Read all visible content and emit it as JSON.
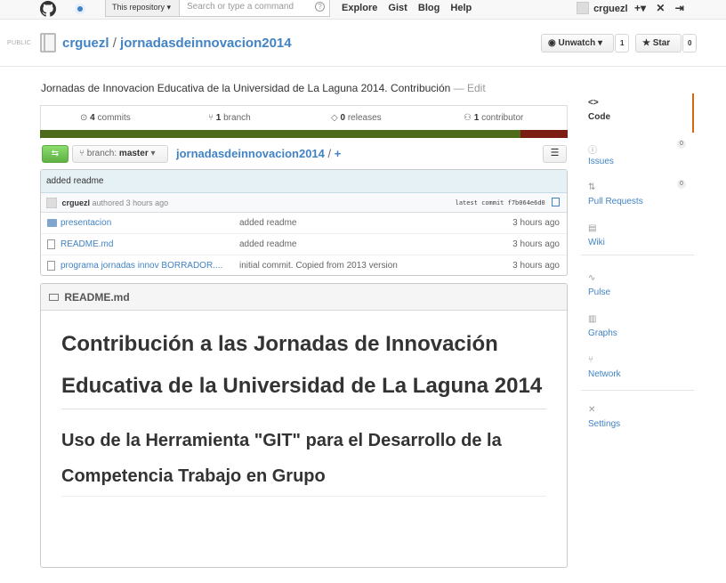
{
  "header": {
    "scope_label": "This repository",
    "search_placeholder": "Search or type a command",
    "help_glyph": "?",
    "nav": [
      "Explore",
      "Gist",
      "Blog",
      "Help"
    ],
    "username": "crguezl",
    "icons": [
      "plus-icon",
      "tools-icon",
      "logout-icon"
    ]
  },
  "repo": {
    "visibility": "PUBLIC",
    "owner": "crguezl",
    "name": "jornadasdeinnovacion2014",
    "unwatch_label": "Unwatch",
    "watch_count": "1",
    "star_label": "Star",
    "star_count": "0",
    "description": "Jornadas de Innovacion Educativa de la Universidad de La Laguna 2014. Contribución",
    "edit_label": "— Edit"
  },
  "summary": {
    "commits_count": "4",
    "commits_label": "commits",
    "branches_count": "1",
    "branches_label": "branch",
    "releases_count": "0",
    "releases_label": "releases",
    "contributors_count": "1",
    "contributors_label": "contributor",
    "colors": {
      "primary_language": "#4c6a19",
      "secondary_language": "#7c1d14"
    }
  },
  "file_nav": {
    "branch_prefix": "branch:",
    "branch_name": "master",
    "path_repo": "jornadasdeinnovacion2014",
    "path_plus": "+"
  },
  "commit": {
    "message": "added readme",
    "author": "crguezl",
    "authored_text": "authored 3 hours ago",
    "latest_label": "latest commit",
    "sha": "f7b064e6d0"
  },
  "files": [
    {
      "type": "folder",
      "name": "presentacion",
      "message": "added readme",
      "age": "3 hours ago"
    },
    {
      "type": "file",
      "name": "README.md",
      "message": "added readme",
      "age": "3 hours ago"
    },
    {
      "type": "file",
      "name": "programa jornadas innov BORRADOR....",
      "message": "initial commit. Copied from 2013 version",
      "age": "3 hours ago"
    }
  ],
  "readme": {
    "title": "README.md",
    "h1": "Contribución a las Jornadas de Innovación Educativa de la Universidad de La Laguna 2014",
    "h2": "Uso de la Herramienta \"GIT\" para el Desarrollo de la Competencia Trabajo en Grupo"
  },
  "sidebar": {
    "items": [
      {
        "label": "Code",
        "icon": "code-icon",
        "glyph": "<>"
      },
      {
        "label": "Issues",
        "icon": "issues-icon",
        "glyph": "ⓘ",
        "count": "0"
      },
      {
        "label": "Pull Requests",
        "icon": "pull-request-icon",
        "glyph": "⇅",
        "count": "0"
      },
      {
        "label": "Wiki",
        "icon": "wiki-icon",
        "glyph": "▤"
      },
      {
        "label": "Pulse",
        "icon": "pulse-icon",
        "glyph": "∿"
      },
      {
        "label": "Graphs",
        "icon": "graph-icon",
        "glyph": "▥"
      },
      {
        "label": "Network",
        "icon": "network-icon",
        "glyph": "⑂"
      },
      {
        "label": "Settings",
        "icon": "settings-icon",
        "glyph": "✕"
      }
    ]
  }
}
